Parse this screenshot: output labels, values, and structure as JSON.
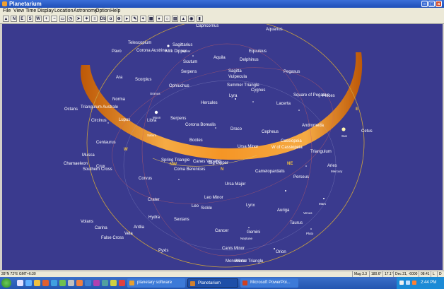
{
  "window": {
    "title": "Planetarium"
  },
  "menu": [
    "File",
    "View",
    "Time",
    "Display",
    "Location",
    "Astronomy",
    "Option",
    "Help"
  ],
  "toolbar": {
    "buttons": [
      {
        "name": "rocket-icon",
        "label": "▲"
      },
      {
        "name": "north-button",
        "label": "N"
      },
      {
        "name": "east-button",
        "label": "E"
      },
      {
        "name": "south-button",
        "label": "S"
      },
      {
        "name": "west-button",
        "label": "W"
      },
      {
        "name": "zoom-in-icon",
        "label": "+"
      },
      {
        "name": "zoom-out-icon",
        "label": "−"
      },
      {
        "name": "frame-icon",
        "label": "▭"
      },
      {
        "name": "clock-icon",
        "label": "◷"
      },
      {
        "name": "arrow-icon",
        "label": "➤"
      },
      {
        "name": "star-icon",
        "label": "✶"
      },
      {
        "name": "list-icon",
        "label": "≡"
      },
      {
        "name": "db-icon",
        "label": "Db"
      },
      {
        "name": "alpha-icon",
        "label": "α"
      },
      {
        "name": "target-icon",
        "label": "⊕"
      },
      {
        "name": "forward-icon",
        "label": "▸"
      },
      {
        "name": "pen-icon",
        "label": "✎"
      },
      {
        "name": "scope-icon",
        "label": "⌖"
      },
      {
        "name": "grid-icon",
        "label": "▦"
      },
      {
        "name": "globe-icon",
        "label": "●"
      },
      {
        "name": "sun-icon",
        "label": "☼"
      },
      {
        "name": "chart-icon",
        "label": "▤"
      },
      {
        "name": "landscape-icon",
        "label": "▲"
      },
      {
        "name": "eye-icon",
        "label": "◉"
      },
      {
        "name": "book-icon",
        "label": "▮"
      }
    ]
  },
  "constellations": [
    {
      "name": "Capricornus",
      "l": 274,
      "t": 0
    },
    {
      "name": "Aquarius",
      "l": 373,
      "t": 5
    },
    {
      "name": "Telescopium",
      "l": 178,
      "t": 24
    },
    {
      "name": "Sagittarius",
      "l": 241,
      "t": 27
    },
    {
      "name": "Corona Austrina",
      "l": 190,
      "t": 35
    },
    {
      "name": "Milk Dipper",
      "l": 231,
      "t": 36
    },
    {
      "name": "Pavo",
      "l": 155,
      "t": 36
    },
    {
      "name": "Equuleus",
      "l": 349,
      "t": 36
    },
    {
      "name": "Aquila",
      "l": 299,
      "t": 45
    },
    {
      "name": "Delphinus",
      "l": 336,
      "t": 48
    },
    {
      "name": "Scutum",
      "l": 256,
      "t": 51
    },
    {
      "name": "Serpens",
      "l": 253,
      "t": 65
    },
    {
      "name": "Sagitta",
      "l": 320,
      "t": 64
    },
    {
      "name": "Pegasus",
      "l": 398,
      "t": 65
    },
    {
      "name": "Vulpecula",
      "l": 320,
      "t": 72
    },
    {
      "name": "Ara",
      "l": 161,
      "t": 73
    },
    {
      "name": "Scorpius",
      "l": 188,
      "t": 76
    },
    {
      "name": "Summer Triangle",
      "l": 318,
      "t": 84
    },
    {
      "name": "Ophiuchus",
      "l": 236,
      "t": 85
    },
    {
      "name": "Cygnus",
      "l": 352,
      "t": 91
    },
    {
      "name": "Lyra",
      "l": 321,
      "t": 99
    },
    {
      "name": "Square of Pegasus",
      "l": 412,
      "t": 98
    },
    {
      "name": "Pisces",
      "l": 453,
      "t": 99
    },
    {
      "name": "Norma",
      "l": 156,
      "t": 104
    },
    {
      "name": "Hercules",
      "l": 281,
      "t": 109
    },
    {
      "name": "Lacerta",
      "l": 388,
      "t": 110
    },
    {
      "name": "Triangulum Australe",
      "l": 111,
      "t": 115
    },
    {
      "name": "Octans",
      "l": 88,
      "t": 118
    },
    {
      "name": "Lupus",
      "l": 165,
      "t": 133
    },
    {
      "name": "Serpens",
      "l": 238,
      "t": 131
    },
    {
      "name": "Libra",
      "l": 205,
      "t": 134
    },
    {
      "name": "Circinus",
      "l": 126,
      "t": 134
    },
    {
      "name": "Corona Borealis",
      "l": 259,
      "t": 140
    },
    {
      "name": "Andromeda",
      "l": 424,
      "t": 141
    },
    {
      "name": "Draco",
      "l": 323,
      "t": 146
    },
    {
      "name": "Cepheus",
      "l": 367,
      "t": 150
    },
    {
      "name": "Cetus",
      "l": 508,
      "t": 149
    },
    {
      "name": "Cassiopeia",
      "l": 394,
      "t": 163
    },
    {
      "name": "Centaurus",
      "l": 133,
      "t": 165
    },
    {
      "name": "Bootes",
      "l": 265,
      "t": 162
    },
    {
      "name": "W of Cassiopeia",
      "l": 381,
      "t": 172
    },
    {
      "name": "Ursa Minor",
      "l": 333,
      "t": 171
    },
    {
      "name": "Triangulum",
      "l": 436,
      "t": 178
    },
    {
      "name": "Musca",
      "l": 113,
      "t": 183
    },
    {
      "name": "Spring Triangle",
      "l": 225,
      "t": 190
    },
    {
      "name": "Canes Venatici",
      "l": 270,
      "t": 192
    },
    {
      "name": "Big Dipper",
      "l": 292,
      "t": 194
    },
    {
      "name": "Chamaeleon",
      "l": 87,
      "t": 195
    },
    {
      "name": "Crux",
      "l": 133,
      "t": 199
    },
    {
      "name": "Aries",
      "l": 460,
      "t": 198
    },
    {
      "name": "Southern Cross",
      "l": 114,
      "t": 203
    },
    {
      "name": "Coma Berenices",
      "l": 243,
      "t": 203
    },
    {
      "name": "Camelopardalis",
      "l": 358,
      "t": 206
    },
    {
      "name": "Corvus",
      "l": 193,
      "t": 216
    },
    {
      "name": "Perseus",
      "l": 412,
      "t": 214
    },
    {
      "name": "Ursa Major",
      "l": 315,
      "t": 224
    },
    {
      "name": "Leo Minor",
      "l": 286,
      "t": 243
    },
    {
      "name": "Crater",
      "l": 206,
      "t": 246
    },
    {
      "name": "Lynx",
      "l": 345,
      "t": 254
    },
    {
      "name": "Leo",
      "l": 268,
      "t": 255
    },
    {
      "name": "Sickle",
      "l": 281,
      "t": 258
    },
    {
      "name": "Auriga",
      "l": 389,
      "t": 261
    },
    {
      "name": "Hydra",
      "l": 207,
      "t": 271
    },
    {
      "name": "Sextans",
      "l": 243,
      "t": 274
    },
    {
      "name": "Volans",
      "l": 111,
      "t": 277
    },
    {
      "name": "Taurus",
      "l": 407,
      "t": 279
    },
    {
      "name": "Carina",
      "l": 131,
      "t": 286
    },
    {
      "name": "Antlia",
      "l": 186,
      "t": 285
    },
    {
      "name": "Cancer",
      "l": 301,
      "t": 290
    },
    {
      "name": "Gemini",
      "l": 346,
      "t": 292
    },
    {
      "name": "Vela",
      "l": 173,
      "t": 294
    },
    {
      "name": "False Cross",
      "l": 140,
      "t": 300
    },
    {
      "name": "Canis Minor",
      "l": 311,
      "t": 315
    },
    {
      "name": "Pyxis",
      "l": 221,
      "t": 318
    },
    {
      "name": "Orion",
      "l": 387,
      "t": 320
    },
    {
      "name": "Monoceros",
      "l": 316,
      "t": 333
    },
    {
      "name": "Winter Triangle",
      "l": 329,
      "t": 333
    }
  ],
  "planets": [
    {
      "name": "Jupiter",
      "l": 253,
      "t": 36
    },
    {
      "name": "Uranus",
      "l": 209,
      "t": 96
    },
    {
      "name": "Moon",
      "l": 213,
      "t": 130
    },
    {
      "name": "Saturn",
      "l": 205,
      "t": 155
    },
    {
      "name": "Sun",
      "l": 480,
      "t": 156
    },
    {
      "name": "Mercury",
      "l": 465,
      "t": 206
    },
    {
      "name": "Mars",
      "l": 448,
      "t": 252
    },
    {
      "name": "Venus",
      "l": 426,
      "t": 265
    },
    {
      "name": "Pluto",
      "l": 430,
      "t": 294
    },
    {
      "name": "Neptune",
      "l": 337,
      "t": 301
    }
  ],
  "directions": [
    {
      "name": "E",
      "l": 500,
      "t": 118
    },
    {
      "name": "W",
      "l": 172,
      "t": 175
    },
    {
      "name": "NW",
      "l": 237,
      "t": 196
    },
    {
      "name": "NE",
      "l": 403,
      "t": 195
    },
    {
      "name": "N",
      "l": 309,
      "t": 203
    }
  ],
  "status": {
    "location": "28°N 72°E  GMT+6:30",
    "mag": "Mag 3.3",
    "az": "180.6°",
    "alt": "17.1°",
    "date": "Dec 21, -6000",
    "time": "08:41",
    "mode": "L",
    "flag": "D"
  },
  "taskbar": {
    "items": [
      {
        "label": "planetary software",
        "color": "#e8a030"
      },
      {
        "label": "Planetarium",
        "color": "#d08030"
      },
      {
        "label": "Microsoft PowerPoi...",
        "color": "#d04020"
      }
    ],
    "clock": "2:44 PM"
  }
}
